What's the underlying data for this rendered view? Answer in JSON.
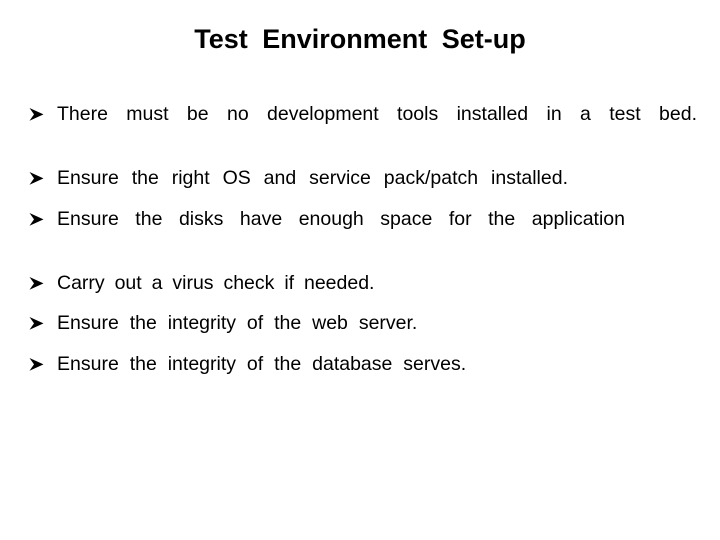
{
  "slide": {
    "title": "Test  Environment  Set-up",
    "background_color": "#ffffff",
    "text_color": "#000000",
    "bullet_glyph": "arrowhead-right",
    "bullets": [
      {
        "text": "There must be no development tools installed in a test bed."
      },
      {
        "text": "Ensure the right OS and service pack/patch installed."
      },
      {
        "text": "Ensure the disks have enough space for the application"
      },
      {
        "text": "Carry out a virus check if needed."
      },
      {
        "text": "Ensure the integrity of the web server."
      },
      {
        "text": "Ensure the integrity of the database serves."
      }
    ]
  }
}
